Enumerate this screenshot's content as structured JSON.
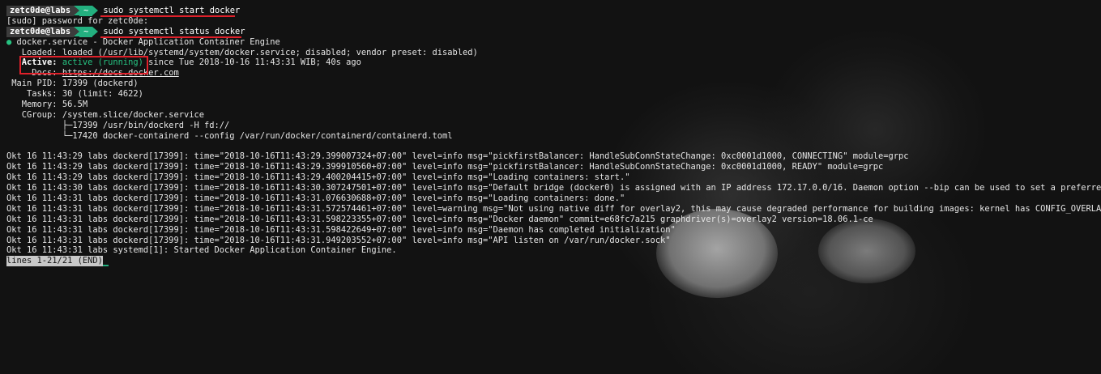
{
  "prompt": {
    "user": "zetc0de@labs",
    "dir": "~"
  },
  "commands": [
    "sudo systemctl start docker",
    "sudo systemctl status docker"
  ],
  "sudo_prompt": "[sudo] password for zetc0de:",
  "status": {
    "bullet": "●",
    "service_line": " docker.service - Docker Application Container Engine",
    "loaded": "   Loaded: loaded (/usr/lib/systemd/system/docker.service; disabled; vendor preset: disabled)",
    "active_label": "   Active: ",
    "active_value": "active (running)",
    "active_rest": " since Tue 2018-10-16 11:43:31 WIB; 40s ago",
    "docs_label": "     Docs: ",
    "docs_url": "https://docs.docker.com",
    "main_pid": " Main PID: 17399 (dockerd)",
    "tasks": "    Tasks: 30 (limit: 4622)",
    "memory": "   Memory: 56.5M",
    "cgroup": "   CGroup: /system.slice/docker.service",
    "cgroup_child1": "           ├─17399 /usr/bin/dockerd -H fd://",
    "cgroup_child2": "           └─17420 docker-containerd --config /var/run/docker/containerd/containerd.toml"
  },
  "logs": [
    "Okt 16 11:43:29 labs dockerd[17399]: time=\"2018-10-16T11:43:29.399007324+07:00\" level=info msg=\"pickfirstBalancer: HandleSubConnStateChange: 0xc0001d1000, CONNECTING\" module=grpc",
    "Okt 16 11:43:29 labs dockerd[17399]: time=\"2018-10-16T11:43:29.399910560+07:00\" level=info msg=\"pickfirstBalancer: HandleSubConnStateChange: 0xc0001d1000, READY\" module=grpc",
    "Okt 16 11:43:29 labs dockerd[17399]: time=\"2018-10-16T11:43:29.400204415+07:00\" level=info msg=\"Loading containers: start.\"",
    "Okt 16 11:43:30 labs dockerd[17399]: time=\"2018-10-16T11:43:30.307247501+07:00\" level=info msg=\"Default bridge (docker0) is assigned with an IP address 172.17.0.0/16. Daemon option --bip can be used to set a preferred IP ",
    "Okt 16 11:43:31 labs dockerd[17399]: time=\"2018-10-16T11:43:31.076630688+07:00\" level=info msg=\"Loading containers: done.\"",
    "Okt 16 11:43:31 labs dockerd[17399]: time=\"2018-10-16T11:43:31.572574461+07:00\" level=warning msg=\"Not using native diff for overlay2, this may cause degraded performance for building images: kernel has CONFIG_OVERLAY_FS_",
    "Okt 16 11:43:31 labs dockerd[17399]: time=\"2018-10-16T11:43:31.598223355+07:00\" level=info msg=\"Docker daemon\" commit=e68fc7a215 graphdriver(s)=overlay2 version=18.06.1-ce",
    "Okt 16 11:43:31 labs dockerd[17399]: time=\"2018-10-16T11:43:31.598422649+07:00\" level=info msg=\"Daemon has completed initialization\"",
    "Okt 16 11:43:31 labs dockerd[17399]: time=\"2018-10-16T11:43:31.949203552+07:00\" level=info msg=\"API listen on /var/run/docker.sock\"",
    "Okt 16 11:43:31 labs systemd[1]: Started Docker Application Container Engine."
  ],
  "truncation_marker": ">",
  "pager_status": "lines 1-21/21 (END)",
  "colors": {
    "prompt_accent": "#23b07f",
    "highlight": "#e0202a",
    "active_green": "#26c281"
  }
}
